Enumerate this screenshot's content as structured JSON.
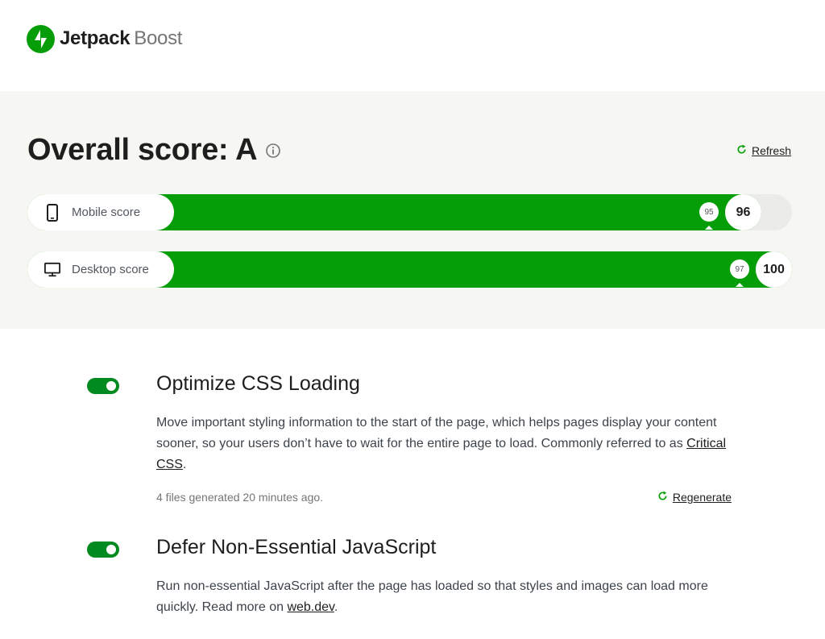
{
  "header": {
    "logo_word1": "Jetpack",
    "logo_word2": "Boost",
    "logo_icon": "jetpack-bolt-icon",
    "brand_color": "#069e08"
  },
  "score": {
    "title": "Overall score: A",
    "info_icon": "info-icon",
    "refresh_label": "Refresh",
    "refresh_icon": "refresh-icon",
    "mobile": {
      "label": "Mobile score",
      "icon": "mobile-phone-icon",
      "score": "96",
      "previous": "95",
      "fill_percent": 96
    },
    "desktop": {
      "label": "Desktop score",
      "icon": "desktop-monitor-icon",
      "score": "100",
      "previous": "97",
      "fill_percent": 100
    }
  },
  "modules": {
    "css": {
      "title": "Optimize CSS Loading",
      "enabled": true,
      "desc_before": "Move important styling information to the start of the page, which helps pages display your content sooner, so your users don’t have to wait for the entire page to load. Commonly referred to as ",
      "desc_link": "Critical CSS",
      "desc_after": ".",
      "meta": "4 files generated 20 minutes ago.",
      "regenerate_label": "Regenerate"
    },
    "js": {
      "title": "Defer Non-Essential JavaScript",
      "enabled": true,
      "desc_before": "Run non-essential JavaScript after the page has loaded so that styles and images can load more quickly. Read more on ",
      "desc_link": "web.dev",
      "desc_after": "."
    }
  },
  "colors": {
    "accent_green": "#069e08",
    "toggle_green": "#008a20",
    "panel_bg": "#f6f7f2"
  }
}
